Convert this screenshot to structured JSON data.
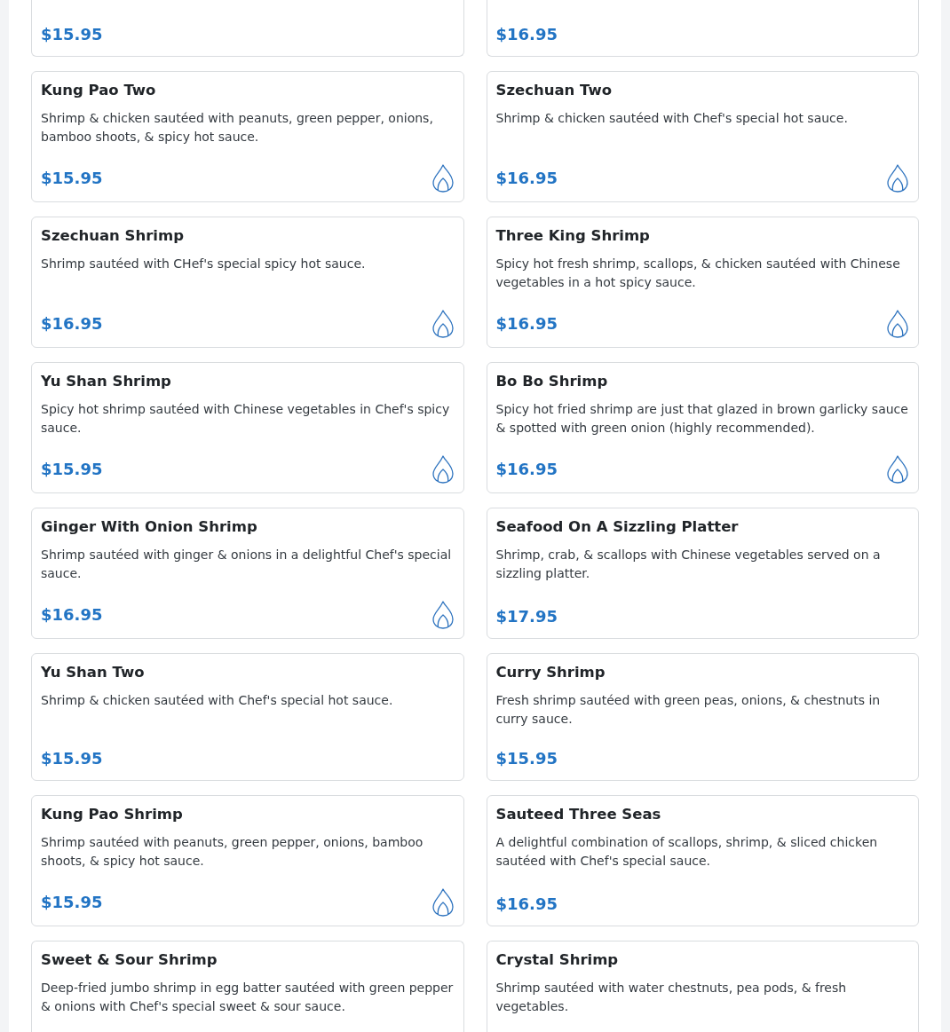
{
  "items": [
    {
      "kind": "cut-top",
      "price": "$15.95"
    },
    {
      "kind": "cut-top",
      "price": "$16.95"
    },
    {
      "kind": "full",
      "name": "Kung Pao Two",
      "description": "Shrimp & chicken sautéed with peanuts, green pepper, onions, bamboo shoots, & spicy hot sauce.",
      "price": "$15.95",
      "spicy": true
    },
    {
      "kind": "full",
      "name": "Szechuan Two",
      "description": "Shrimp & chicken sautéed with Chef's special hot sauce.",
      "price": "$16.95",
      "spicy": true
    },
    {
      "kind": "full",
      "name": "Szechuan Shrimp",
      "description": "Shrimp sautéed with CHef's special spicy hot sauce.",
      "price": "$16.95",
      "spicy": true
    },
    {
      "kind": "full",
      "name": "Three King Shrimp",
      "description": "Spicy hot fresh shrimp, scallops, & chicken sautéed with Chinese vegetables in a hot spicy sauce.",
      "price": "$16.95",
      "spicy": true
    },
    {
      "kind": "full",
      "name": "Yu Shan Shrimp",
      "description": "Spicy hot shrimp sautéed with Chinese vegetables in Chef's spicy sauce.",
      "price": "$15.95",
      "spicy": true
    },
    {
      "kind": "full",
      "name": "Bo Bo Shrimp",
      "description": "Spicy hot fried shrimp are just that glazed in brown garlicky sauce & spotted with green onion (highly recommended).",
      "price": "$16.95",
      "spicy": true
    },
    {
      "kind": "full",
      "name": "Ginger With Onion Shrimp",
      "description": "Shrimp sautéed with ginger & onions in a delightful Chef's special sauce.",
      "price": "$16.95",
      "spicy": true
    },
    {
      "kind": "full",
      "name": "Seafood On A Sizzling Platter",
      "description": "Shrimp, crab, & scallops with Chinese vegetables served on a sizzling platter.",
      "price": "$17.95",
      "spicy": false
    },
    {
      "kind": "full",
      "name": "Yu Shan Two",
      "description": "Shrimp & chicken sautéed with Chef's special hot sauce.",
      "price": "$15.95",
      "spicy": false
    },
    {
      "kind": "full",
      "name": "Curry Shrimp",
      "description": "Fresh shrimp sautéed with green peas, onions, & chestnuts in curry sauce.",
      "price": "$15.95",
      "spicy": false
    },
    {
      "kind": "full",
      "name": "Kung Pao Shrimp",
      "description": "Shrimp sautéed with peanuts, green pepper, onions, bamboo shoots, & spicy hot sauce.",
      "price": "$15.95",
      "spicy": true
    },
    {
      "kind": "full",
      "name": "Sauteed Three Seas",
      "description": "A delightful combination of scallops, shrimp, & sliced chicken sautéed with Chef's special sauce.",
      "price": "$16.95",
      "spicy": false
    },
    {
      "kind": "cut-bottom",
      "name": "Sweet & Sour Shrimp",
      "description": "Deep-fried jumbo shrimp in egg batter sautéed with green pepper & onions with Chef's special sweet & sour sauce."
    },
    {
      "kind": "cut-bottom",
      "name": "Crystal Shrimp",
      "description": "Shrimp sautéed with water chestnuts, pea pods, & fresh vegetables."
    }
  ]
}
